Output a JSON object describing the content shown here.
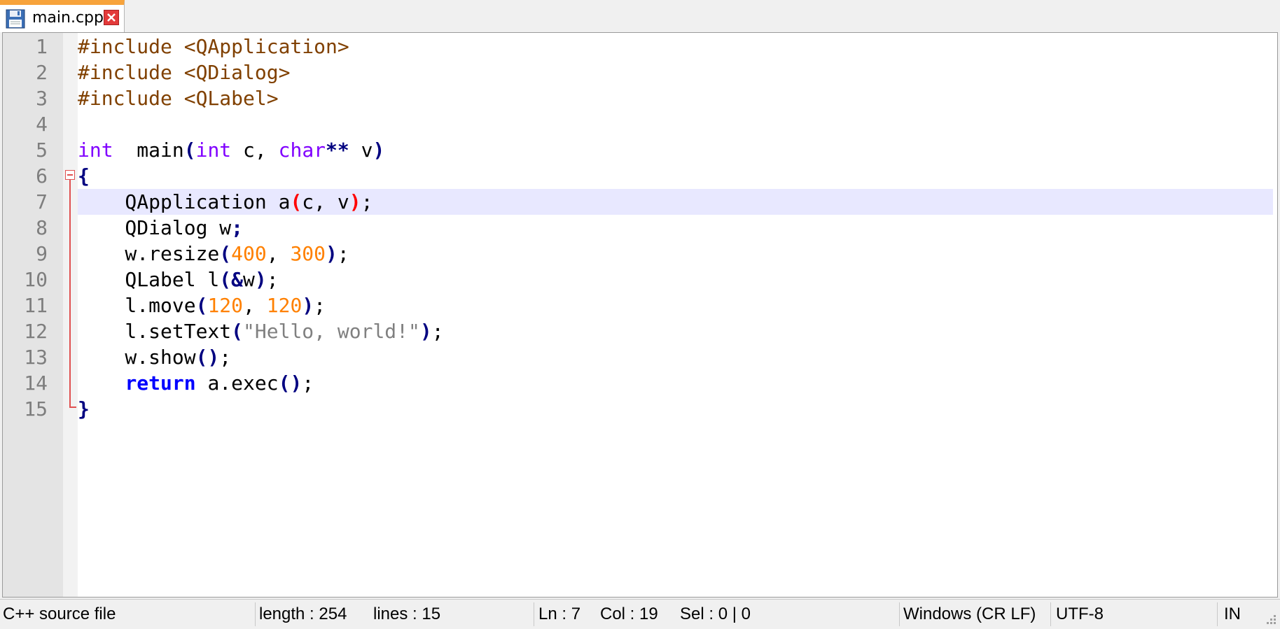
{
  "tabs": [
    {
      "label": "main.cpp",
      "icon": "save-icon",
      "active": true
    }
  ],
  "editor": {
    "current_line": 7,
    "lines": [
      {
        "num": "1",
        "tokens": [
          [
            "pp",
            "#include <QApplication>"
          ]
        ]
      },
      {
        "num": "2",
        "tokens": [
          [
            "pp",
            "#include <QDialog>"
          ]
        ]
      },
      {
        "num": "3",
        "tokens": [
          [
            "pp",
            "#include <QLabel>"
          ]
        ]
      },
      {
        "num": "4",
        "tokens": []
      },
      {
        "num": "5",
        "tokens": [
          [
            "kw",
            "int"
          ],
          [
            "",
            "  main"
          ],
          [
            "op",
            "("
          ],
          [
            "kw",
            "int"
          ],
          [
            "",
            " c, "
          ],
          [
            "kw",
            "char"
          ],
          [
            "op",
            "**"
          ],
          [
            "",
            " v"
          ],
          [
            "op",
            ")"
          ]
        ]
      },
      {
        "num": "6",
        "tokens": [
          [
            "op",
            "{"
          ]
        ]
      },
      {
        "num": "7",
        "tokens": [
          [
            "",
            "    QApplication a"
          ],
          [
            "brace-hl",
            "("
          ],
          [
            "",
            "c, v"
          ],
          [
            "brace-hl",
            ")"
          ],
          [
            "",
            ";"
          ]
        ]
      },
      {
        "num": "8",
        "tokens": [
          [
            "",
            "    QDialog w"
          ],
          [
            "op",
            ";"
          ]
        ]
      },
      {
        "num": "9",
        "tokens": [
          [
            "",
            "    w.resize"
          ],
          [
            "op",
            "("
          ],
          [
            "num",
            "400"
          ],
          [
            "",
            ", "
          ],
          [
            "num",
            "300"
          ],
          [
            "op",
            ")"
          ],
          [
            "",
            ";"
          ]
        ]
      },
      {
        "num": "10",
        "tokens": [
          [
            "",
            "    QLabel l"
          ],
          [
            "op",
            "("
          ],
          [
            "op",
            "&"
          ],
          [
            "",
            "w"
          ],
          [
            "op",
            ")"
          ],
          [
            "",
            ";"
          ]
        ]
      },
      {
        "num": "11",
        "tokens": [
          [
            "",
            "    l.move"
          ],
          [
            "op",
            "("
          ],
          [
            "num",
            "120"
          ],
          [
            "",
            ", "
          ],
          [
            "num",
            "120"
          ],
          [
            "op",
            ")"
          ],
          [
            "",
            ";"
          ]
        ]
      },
      {
        "num": "12",
        "tokens": [
          [
            "",
            "    l.setText"
          ],
          [
            "op",
            "("
          ],
          [
            "str",
            "\"Hello, world!\""
          ],
          [
            "op",
            ")"
          ],
          [
            "",
            ";"
          ]
        ]
      },
      {
        "num": "13",
        "tokens": [
          [
            "",
            "    w.show"
          ],
          [
            "op",
            "()"
          ],
          [
            "",
            ";"
          ]
        ]
      },
      {
        "num": "14",
        "tokens": [
          [
            "",
            "    "
          ],
          [
            "rw",
            "return"
          ],
          [
            "",
            " a.exec"
          ],
          [
            "op",
            "()"
          ],
          [
            "",
            ";"
          ]
        ]
      },
      {
        "num": "15",
        "tokens": [
          [
            "op",
            "}"
          ]
        ]
      }
    ]
  },
  "statusbar": {
    "file_type": "C++ source file",
    "length": "length : 254",
    "lines": "lines : 15",
    "ln": "Ln : 7",
    "col": "Col : 19",
    "sel": "Sel : 0 | 0",
    "eol": "Windows (CR LF)",
    "encoding": "UTF-8",
    "mode": "IN"
  },
  "colors": {
    "tab_accent": "#f7a33b",
    "current_line": "#e8e8ff",
    "preprocessor": "#804000",
    "type_keyword": "#8000ff",
    "keyword": "#0000ff",
    "operator": "#000080",
    "number": "#ff8000",
    "string": "#808080",
    "brace_match": "#ff0000",
    "fold_marker": "#e05050"
  }
}
